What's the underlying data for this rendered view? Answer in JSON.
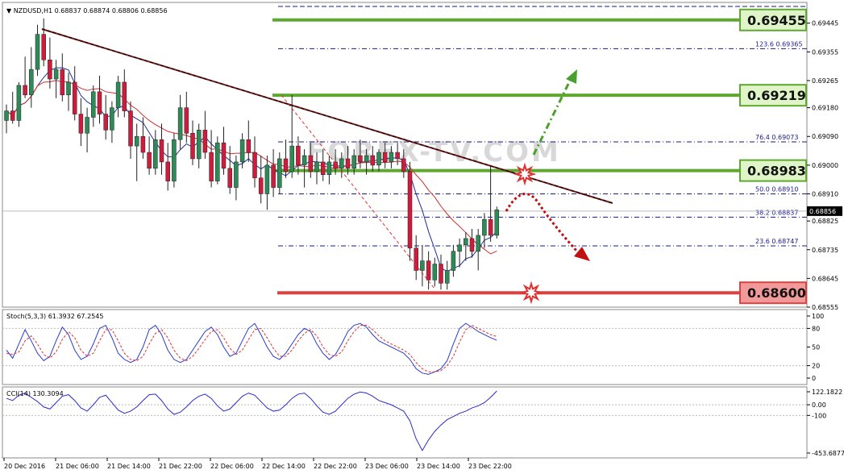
{
  "header": {
    "symbol": "NZDUSD,H1",
    "ohlc": "0.68837 0.68874 0.68806 0.68856"
  },
  "watermark": "FOREX-TV.COM",
  "colors": {
    "bull_candle": "#2e8b57",
    "bear_candle": "#d01c3c",
    "ma_fast": "#1f2f9a",
    "ma_slow": "#d03030",
    "level_green": "#5ea832",
    "level_red": "#e04040",
    "trendline": "#222222",
    "stoch_main": "#2a3bd0",
    "stoch_signal": "#e03030",
    "cci": "#2a2ad0"
  },
  "chart_data": [
    {
      "type": "candlestick",
      "title": "NZDUSD,H1",
      "ylim": [
        0.68555,
        0.6951
      ],
      "price_ticks": [
        "0.69445",
        "0.69355",
        "0.69265",
        "0.69180",
        "0.69090",
        "0.69000",
        "0.68910",
        "0.68825",
        "0.68735",
        "0.68645",
        "0.68555"
      ],
      "current_price": "0.68856",
      "x_tick_labels": [
        "20 Dec 2016",
        "21 Dec 06:00",
        "21 Dec 14:00",
        "21 Dec 22:00",
        "22 Dec 06:00",
        "22 Dec 14:00",
        "22 Dec 22:00",
        "23 Dec 06:00",
        "23 Dec 14:00",
        "23 Dec 22:00"
      ],
      "levels": [
        {
          "label": "0.69455",
          "value": 0.69455,
          "color": "green"
        },
        {
          "label": "0.69219",
          "value": 0.69219,
          "color": "green"
        },
        {
          "label": "0.68983",
          "value": 0.68983,
          "color": "green"
        },
        {
          "label": "0.68600",
          "value": 0.686,
          "color": "red"
        }
      ],
      "fibonacci": [
        {
          "level": "123.6",
          "price": "0.69365"
        },
        {
          "level": "76.4",
          "price": "0.69073"
        },
        {
          "level": "50.0",
          "price": "0.68910"
        },
        {
          "level": "38.2",
          "price": "0.68837"
        },
        {
          "level": "23.6",
          "price": "0.68747"
        }
      ],
      "candles": [
        {
          "o": 0.6914,
          "h": 0.6919,
          "l": 0.691,
          "c": 0.6917
        },
        {
          "o": 0.6917,
          "h": 0.6923,
          "l": 0.6913,
          "c": 0.6914
        },
        {
          "o": 0.6914,
          "h": 0.6926,
          "l": 0.6912,
          "c": 0.6925
        },
        {
          "o": 0.6925,
          "h": 0.6934,
          "l": 0.6921,
          "c": 0.6922
        },
        {
          "o": 0.6922,
          "h": 0.6937,
          "l": 0.6918,
          "c": 0.693
        },
        {
          "o": 0.693,
          "h": 0.6944,
          "l": 0.6928,
          "c": 0.6941
        },
        {
          "o": 0.6941,
          "h": 0.6946,
          "l": 0.6931,
          "c": 0.6933
        },
        {
          "o": 0.6933,
          "h": 0.694,
          "l": 0.6924,
          "c": 0.6927
        },
        {
          "o": 0.6927,
          "h": 0.6933,
          "l": 0.6921,
          "c": 0.693
        },
        {
          "o": 0.693,
          "h": 0.6935,
          "l": 0.692,
          "c": 0.6922
        },
        {
          "o": 0.6922,
          "h": 0.6929,
          "l": 0.6917,
          "c": 0.6926
        },
        {
          "o": 0.6926,
          "h": 0.6931,
          "l": 0.6914,
          "c": 0.6916
        },
        {
          "o": 0.6916,
          "h": 0.6921,
          "l": 0.6906,
          "c": 0.691
        },
        {
          "o": 0.691,
          "h": 0.6918,
          "l": 0.6904,
          "c": 0.6915
        },
        {
          "o": 0.6915,
          "h": 0.6925,
          "l": 0.6912,
          "c": 0.6923
        },
        {
          "o": 0.6923,
          "h": 0.6928,
          "l": 0.6913,
          "c": 0.6916
        },
        {
          "o": 0.6916,
          "h": 0.6922,
          "l": 0.6908,
          "c": 0.6911
        },
        {
          "o": 0.6911,
          "h": 0.692,
          "l": 0.6907,
          "c": 0.6918
        },
        {
          "o": 0.6918,
          "h": 0.6928,
          "l": 0.6915,
          "c": 0.6926
        },
        {
          "o": 0.6926,
          "h": 0.693,
          "l": 0.6915,
          "c": 0.6917
        },
        {
          "o": 0.6917,
          "h": 0.692,
          "l": 0.6902,
          "c": 0.6906
        },
        {
          "o": 0.6906,
          "h": 0.6913,
          "l": 0.6895,
          "c": 0.6909
        },
        {
          "o": 0.6909,
          "h": 0.6915,
          "l": 0.6902,
          "c": 0.6904
        },
        {
          "o": 0.6904,
          "h": 0.6909,
          "l": 0.6897,
          "c": 0.6899
        },
        {
          "o": 0.6899,
          "h": 0.6911,
          "l": 0.6897,
          "c": 0.6908
        },
        {
          "o": 0.6908,
          "h": 0.6913,
          "l": 0.6897,
          "c": 0.6901
        },
        {
          "o": 0.6901,
          "h": 0.6907,
          "l": 0.6892,
          "c": 0.6895
        },
        {
          "o": 0.6895,
          "h": 0.691,
          "l": 0.6893,
          "c": 0.6908
        },
        {
          "o": 0.6908,
          "h": 0.6922,
          "l": 0.6905,
          "c": 0.6918
        },
        {
          "o": 0.6918,
          "h": 0.6923,
          "l": 0.6907,
          "c": 0.691
        },
        {
          "o": 0.691,
          "h": 0.6914,
          "l": 0.69,
          "c": 0.6902
        },
        {
          "o": 0.6902,
          "h": 0.6913,
          "l": 0.6899,
          "c": 0.6911
        },
        {
          "o": 0.6911,
          "h": 0.6917,
          "l": 0.6902,
          "c": 0.6904
        },
        {
          "o": 0.6904,
          "h": 0.6911,
          "l": 0.6893,
          "c": 0.6895
        },
        {
          "o": 0.6895,
          "h": 0.6909,
          "l": 0.6894,
          "c": 0.6907
        },
        {
          "o": 0.6907,
          "h": 0.6912,
          "l": 0.6897,
          "c": 0.6899
        },
        {
          "o": 0.6899,
          "h": 0.6906,
          "l": 0.6891,
          "c": 0.6893
        },
        {
          "o": 0.6893,
          "h": 0.6903,
          "l": 0.6889,
          "c": 0.6901
        },
        {
          "o": 0.6901,
          "h": 0.691,
          "l": 0.6899,
          "c": 0.6908
        },
        {
          "o": 0.6908,
          "h": 0.6914,
          "l": 0.6901,
          "c": 0.6904
        },
        {
          "o": 0.6904,
          "h": 0.6909,
          "l": 0.6893,
          "c": 0.6896
        },
        {
          "o": 0.6896,
          "h": 0.6903,
          "l": 0.6888,
          "c": 0.6891
        },
        {
          "o": 0.6891,
          "h": 0.6903,
          "l": 0.6886,
          "c": 0.69
        },
        {
          "o": 0.69,
          "h": 0.6905,
          "l": 0.689,
          "c": 0.6893
        },
        {
          "o": 0.6893,
          "h": 0.6904,
          "l": 0.6891,
          "c": 0.6902
        },
        {
          "o": 0.6902,
          "h": 0.6908,
          "l": 0.6896,
          "c": 0.6898
        },
        {
          "o": 0.6898,
          "h": 0.6922,
          "l": 0.6896,
          "c": 0.6906
        },
        {
          "o": 0.6906,
          "h": 0.6909,
          "l": 0.6897,
          "c": 0.69
        },
        {
          "o": 0.69,
          "h": 0.6905,
          "l": 0.6893,
          "c": 0.6903
        },
        {
          "o": 0.6903,
          "h": 0.6907,
          "l": 0.6896,
          "c": 0.6898
        },
        {
          "o": 0.6898,
          "h": 0.6904,
          "l": 0.6894,
          "c": 0.6901
        },
        {
          "o": 0.6901,
          "h": 0.6905,
          "l": 0.6895,
          "c": 0.6897
        },
        {
          "o": 0.6897,
          "h": 0.6903,
          "l": 0.6894,
          "c": 0.6901
        },
        {
          "o": 0.6901,
          "h": 0.6905,
          "l": 0.6897,
          "c": 0.6899
        },
        {
          "o": 0.6899,
          "h": 0.6904,
          "l": 0.6896,
          "c": 0.6902
        },
        {
          "o": 0.6902,
          "h": 0.6906,
          "l": 0.6897,
          "c": 0.6899
        },
        {
          "o": 0.6899,
          "h": 0.6905,
          "l": 0.6897,
          "c": 0.6903
        },
        {
          "o": 0.6903,
          "h": 0.6908,
          "l": 0.6899,
          "c": 0.6901
        },
        {
          "o": 0.6901,
          "h": 0.6905,
          "l": 0.6897,
          "c": 0.6903
        },
        {
          "o": 0.6903,
          "h": 0.6906,
          "l": 0.6898,
          "c": 0.69
        },
        {
          "o": 0.69,
          "h": 0.6905,
          "l": 0.6898,
          "c": 0.6904
        },
        {
          "o": 0.6904,
          "h": 0.6907,
          "l": 0.6899,
          "c": 0.6901
        },
        {
          "o": 0.6901,
          "h": 0.6906,
          "l": 0.6899,
          "c": 0.6904
        },
        {
          "o": 0.6904,
          "h": 0.6907,
          "l": 0.69,
          "c": 0.6902
        },
        {
          "o": 0.6902,
          "h": 0.6905,
          "l": 0.6896,
          "c": 0.6898
        },
        {
          "o": 0.6898,
          "h": 0.6901,
          "l": 0.687,
          "c": 0.6874
        },
        {
          "o": 0.6874,
          "h": 0.6878,
          "l": 0.6864,
          "c": 0.6867
        },
        {
          "o": 0.6867,
          "h": 0.6875,
          "l": 0.6862,
          "c": 0.687
        },
        {
          "o": 0.687,
          "h": 0.6873,
          "l": 0.6861,
          "c": 0.6864
        },
        {
          "o": 0.6864,
          "h": 0.6871,
          "l": 0.6862,
          "c": 0.6869
        },
        {
          "o": 0.6869,
          "h": 0.6872,
          "l": 0.6861,
          "c": 0.6863
        },
        {
          "o": 0.6863,
          "h": 0.687,
          "l": 0.6861,
          "c": 0.6867
        },
        {
          "o": 0.6867,
          "h": 0.6875,
          "l": 0.6865,
          "c": 0.6873
        },
        {
          "o": 0.6873,
          "h": 0.6877,
          "l": 0.6868,
          "c": 0.6875
        },
        {
          "o": 0.6875,
          "h": 0.6879,
          "l": 0.687,
          "c": 0.6877
        },
        {
          "o": 0.6877,
          "h": 0.688,
          "l": 0.6871,
          "c": 0.6873
        },
        {
          "o": 0.6873,
          "h": 0.688,
          "l": 0.6867,
          "c": 0.6878
        },
        {
          "o": 0.6878,
          "h": 0.6885,
          "l": 0.6874,
          "c": 0.6883
        },
        {
          "o": 0.6883,
          "h": 0.69,
          "l": 0.6876,
          "c": 0.6878
        },
        {
          "o": 0.6878,
          "h": 0.6887,
          "l": 0.6877,
          "c": 0.6886
        }
      ]
    },
    {
      "type": "line",
      "title": "Stoch(5,3,3) 61.3932 67.2545",
      "ylim": [
        0,
        100
      ],
      "y_ticks": [
        "100",
        "80",
        "50",
        "20",
        "0"
      ],
      "series": [
        {
          "name": "main",
          "values": [
            45,
            32,
            55,
            78,
            60,
            40,
            28,
            35,
            60,
            82,
            70,
            45,
            30,
            35,
            55,
            80,
            85,
            65,
            40,
            30,
            25,
            30,
            50,
            78,
            85,
            70,
            45,
            30,
            25,
            30,
            45,
            60,
            75,
            82,
            70,
            50,
            35,
            40,
            60,
            80,
            88,
            70,
            50,
            35,
            30,
            40,
            55,
            70,
            80,
            75,
            55,
            40,
            30,
            38,
            55,
            75,
            85,
            88,
            82,
            70,
            60,
            55,
            50,
            45,
            40,
            30,
            15,
            8,
            6,
            10,
            15,
            28,
            55,
            80,
            88,
            82,
            75,
            70,
            65,
            61
          ]
        },
        {
          "name": "signal",
          "values": [
            40,
            38,
            42,
            60,
            68,
            55,
            38,
            32,
            42,
            62,
            75,
            65,
            45,
            35,
            40,
            60,
            78,
            78,
            60,
            40,
            30,
            28,
            35,
            55,
            72,
            78,
            65,
            45,
            32,
            28,
            35,
            48,
            62,
            75,
            78,
            65,
            48,
            38,
            45,
            62,
            78,
            80,
            65,
            48,
            35,
            35,
            45,
            60,
            72,
            78,
            68,
            50,
            38,
            35,
            42,
            60,
            75,
            85,
            85,
            78,
            68,
            60,
            55,
            50,
            45,
            38,
            25,
            15,
            10,
            10,
            12,
            20,
            35,
            58,
            78,
            85,
            80,
            75,
            70,
            67
          ]
        }
      ]
    },
    {
      "type": "line",
      "title": "CCI(14) 130.3094",
      "y_ticks": [
        "122.1822",
        "0.00",
        "-100",
        "-453.6877"
      ],
      "ylim": [
        -453.6877,
        122.1822
      ],
      "series": [
        {
          "name": "cci",
          "values": [
            60,
            40,
            90,
            110,
            70,
            30,
            -20,
            -40,
            20,
            80,
            95,
            40,
            -30,
            -60,
            0,
            70,
            90,
            20,
            -50,
            -80,
            -60,
            -20,
            40,
            95,
            100,
            40,
            -40,
            -90,
            -70,
            -20,
            40,
            80,
            100,
            60,
            -10,
            -60,
            -40,
            20,
            80,
            110,
            90,
            30,
            -30,
            -60,
            -50,
            0,
            60,
            100,
            110,
            60,
            -10,
            -70,
            -90,
            -60,
            0,
            60,
            100,
            120,
            110,
            80,
            40,
            20,
            0,
            -30,
            -60,
            -150,
            -320,
            -430,
            -330,
            -250,
            -190,
            -140,
            -110,
            -80,
            -60,
            -30,
            -10,
            20,
            70,
            130
          ]
        }
      ]
    }
  ]
}
